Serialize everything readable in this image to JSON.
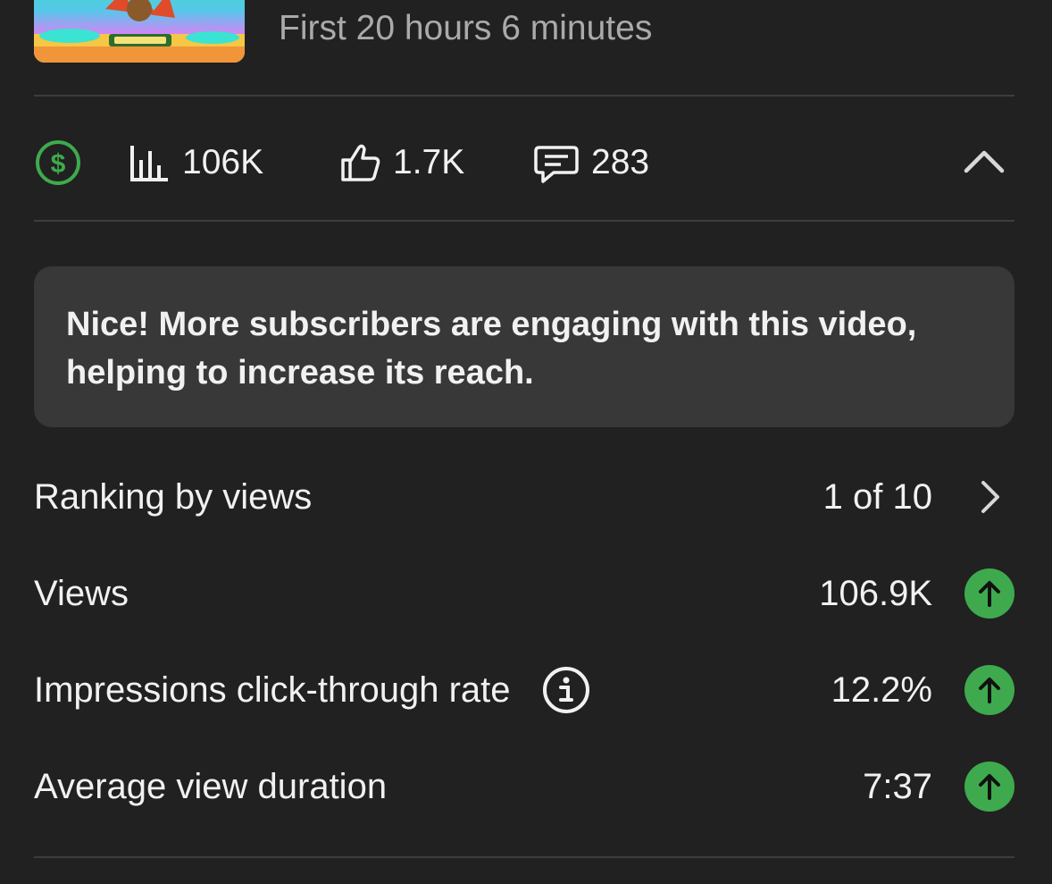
{
  "video": {
    "subtitle": "First 20 hours 6 minutes"
  },
  "stats": {
    "monetization_icon": "dollar-circle-icon",
    "monetization_color": "#3eaa4d",
    "views": "106K",
    "likes": "1.7K",
    "comments": "283"
  },
  "insight": {
    "text": "Nice! More subscribers are engaging with this video, helping to increase its reach."
  },
  "metrics": {
    "ranking": {
      "label": "Ranking by views",
      "value": "1 of 10"
    },
    "views": {
      "label": "Views",
      "value": "106.9K",
      "trend": "up"
    },
    "ctr": {
      "label": "Impressions click-through rate",
      "value": "12.2%",
      "trend": "up"
    },
    "avg_duration": {
      "label": "Average view duration",
      "value": "7:37",
      "trend": "up"
    }
  },
  "colors": {
    "background": "#212121",
    "card": "#383838",
    "trend_up": "#3eaa4d"
  }
}
